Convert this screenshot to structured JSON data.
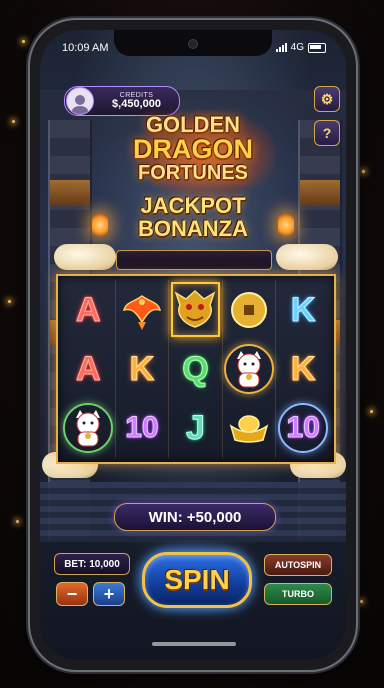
{
  "status_bar": {
    "time": "10:09 AM",
    "network": "4G"
  },
  "balance": {
    "label": "CREDITS",
    "value": "$,450,000"
  },
  "hud": {
    "settings_icon": "gear-icon",
    "help_label": "?"
  },
  "title": {
    "line1": "GOLDEN",
    "line2": "DRAGON",
    "line3": "FORTUNES"
  },
  "subtitle": {
    "line1": "JACKPOT",
    "line2": "BONANZA"
  },
  "reels": {
    "rows": [
      [
        "A",
        "phoenix",
        "dragon",
        "coin",
        "K"
      ],
      [
        "A",
        "K",
        "Q",
        "lucky-cat",
        "K"
      ],
      [
        "lucky-cat",
        "10",
        "J",
        "gold-ingot",
        "10"
      ]
    ]
  },
  "win": {
    "label": "WIN:",
    "value": "+50,000"
  },
  "bet": {
    "label": "BET:",
    "value": "10,000",
    "minus": "−",
    "plus": "+"
  },
  "spin": {
    "label": "SPIN"
  },
  "side_buttons": {
    "autospin": "AUTOSPIN",
    "turbo": "TURBO"
  },
  "colors": {
    "accent_gold": "#e6b04a",
    "spin_blue": "#2a6fe6",
    "frame_purple": "#b48cff"
  }
}
